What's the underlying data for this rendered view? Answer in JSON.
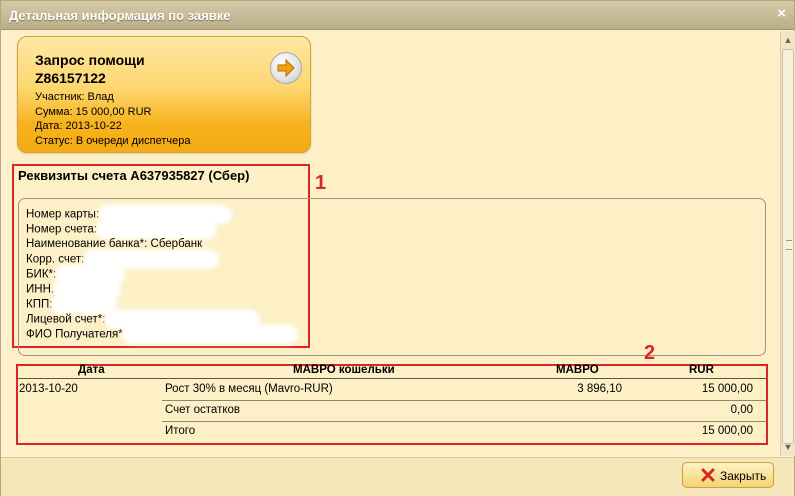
{
  "dialog": {
    "title": "Детальная информация по заявке",
    "close_glyph": "×"
  },
  "card": {
    "title_line1": "Запрос помощи",
    "title_line2": "Z86157122",
    "participant": "Участник: Влад",
    "amount": "Сумма: 15 000,00 RUR",
    "date": "Дата: 2013-10-22",
    "status": "Статус: В очереди диспетчера",
    "go_icon": "arrow-right-icon"
  },
  "requisites": {
    "title": "Реквизиты счета A637935827 (Сбер)",
    "fields": [
      {
        "label": "Номер карты:",
        "value": ""
      },
      {
        "label": "Номер счета:",
        "value": ""
      },
      {
        "label": "Наименование банка*: Сбербанк",
        "value": ""
      },
      {
        "label": "Корр. счет:",
        "value": ""
      },
      {
        "label": "БИК*:",
        "value": ""
      },
      {
        "label": "ИНН.",
        "value": ""
      },
      {
        "label": "КПП:",
        "value": ""
      },
      {
        "label": "Лицевой счет*:",
        "value": ""
      },
      {
        "label": "ФИО Получателя*",
        "value": ""
      }
    ]
  },
  "annotations": {
    "label1": "1",
    "label2": "2",
    "color": "#d8262e"
  },
  "chart_data": {
    "type": "table",
    "columns": [
      "Дата",
      "МАВРО кошельки",
      "МАВРО",
      "RUR"
    ],
    "rows": [
      [
        "2013-10-20",
        "Рост 30% в месяц (Mavro-RUR)",
        "3 896,10",
        "15 000,00"
      ],
      [
        "",
        "Счет остатков",
        "",
        "0,00"
      ],
      [
        "",
        "Итого",
        "",
        "15 000,00"
      ]
    ]
  },
  "footer": {
    "close_label": "Закрыть",
    "close_icon": "red-x-icon"
  },
  "colors": {
    "accent": "#f6b31e",
    "background": "#fdf0c7",
    "annotation_red": "#d8262e"
  }
}
